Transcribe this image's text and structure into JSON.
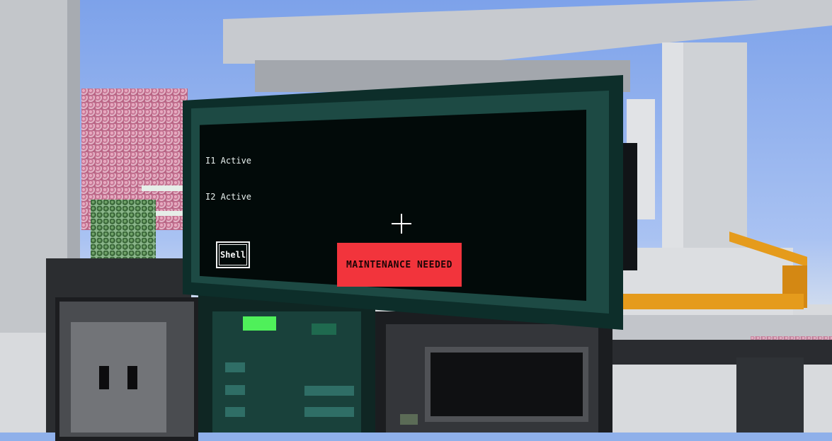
{
  "terminal": {
    "status_lines": [
      "I1 Active",
      "I2 Active"
    ],
    "shell_button_label": "Shell",
    "alert_label": "MAINTENANCE NEEDED"
  },
  "hud": {
    "crosshair_icon": "crosshair-icon"
  },
  "colors": {
    "screen": "#020a09",
    "frame": "#0d2e2a",
    "alert": "#f2343c",
    "pipe": "#e59b1c",
    "indicator": "#4ff05a"
  }
}
